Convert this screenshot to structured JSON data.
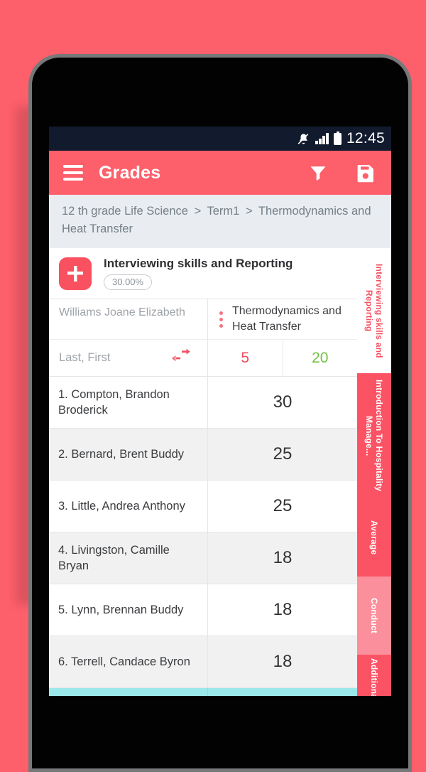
{
  "status_bar": {
    "time": "12:45",
    "icons": [
      "bell-muted-icon",
      "signal-bars-icon",
      "battery-icon"
    ],
    "background": "#121a2e"
  },
  "app_bar": {
    "title": "Grades",
    "menu_icon": "hamburger-icon",
    "filter_icon": "filter-funnel-icon",
    "save_icon": "floppy-save-icon",
    "background": "#fd5f6b"
  },
  "breadcrumb": {
    "parts": [
      "12 th grade Life Science",
      "Term1",
      "Thermodynamics and Heat Transfer"
    ],
    "separator": ">"
  },
  "assignment": {
    "add_label": "+",
    "title": "Interviewing skills and Reporting",
    "weight": "30.00%"
  },
  "table": {
    "teacher_name": "Williams Joane Elizabeth",
    "column_title": "Thermodynamics and Heat Transfer",
    "sort_label": "Last, First",
    "sort_icon": "swap-arrows-icon",
    "kebab_icon": "more-vertical-icon",
    "max_points": "5",
    "total_points": "20",
    "rows": [
      {
        "name": "1. Compton, Brandon Broderick",
        "grade": "30"
      },
      {
        "name": "2. Bernard, Brent Buddy",
        "grade": "25"
      },
      {
        "name": "3. Little, Andrea Anthony",
        "grade": "25"
      },
      {
        "name": "4. Livingston, Camille Bryan",
        "grade": "18"
      },
      {
        "name": "5. Lynn, Brennan Buddy",
        "grade": "18"
      },
      {
        "name": "6. Terrell, Candace Byron",
        "grade": "18"
      }
    ]
  },
  "tabs": [
    {
      "label": "Interviewing skills and Reporting",
      "state": "active"
    },
    {
      "label": "Introduction To Hospitality Manage...",
      "state": "solid"
    },
    {
      "label": "Average",
      "state": "solid"
    },
    {
      "label": "Conduct",
      "state": "light"
    },
    {
      "label": "Additional Grade",
      "state": "solid"
    }
  ],
  "colors": {
    "accent": "#fd5f6b",
    "page_background": "#fd5f6b",
    "breadcrumb_bg": "#e9edf1",
    "max_points": "#ef4b5b",
    "total_points": "#74c043",
    "summary_bar": "#9ae8ea"
  }
}
